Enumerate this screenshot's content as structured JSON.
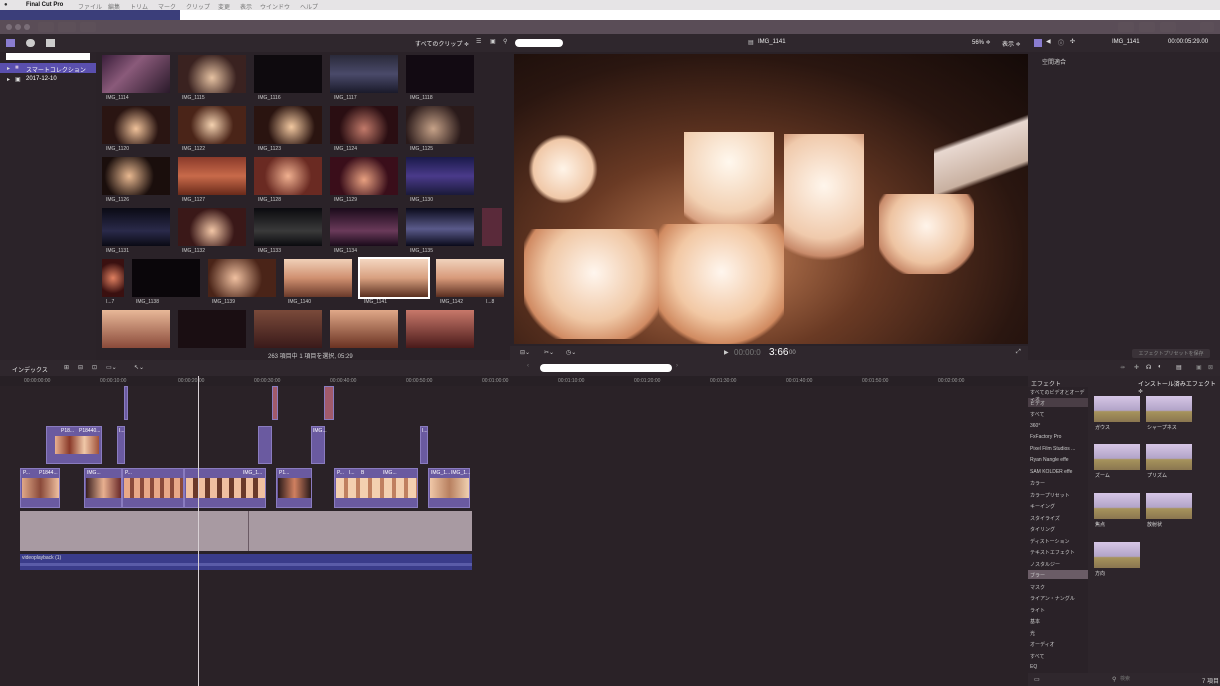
{
  "menubar": {
    "app": "Final Cut Pro",
    "items": [
      "ファイル",
      "編集",
      "トリム",
      "マーク",
      "クリップ",
      "変更",
      "表示",
      "ウインドウ",
      "ヘルプ"
    ]
  },
  "browser": {
    "filter": "すべてのクリップ ≑",
    "status": "263 項目中 1 項目を選択, 05:29",
    "clips": [
      "IMG_1114",
      "IMG_1115",
      "IMG_1116",
      "IMG_1117",
      "IMG_1118",
      "IMG_1120",
      "IMG_1122",
      "IMG_1123",
      "IMG_1124",
      "IMG_1125",
      "IMG_1126",
      "IMG_1127",
      "IMG_1128",
      "IMG_1129",
      "IMG_1130",
      "IMG_1131",
      "IMG_1132",
      "IMG_1133",
      "IMG_1134",
      "IMG_1135",
      "I...7",
      "IMG_1138",
      "IMG_1139",
      "IMG_1140",
      "IMG_1141",
      "IMG_1142",
      "I...8"
    ]
  },
  "library": {
    "items": [
      "スマートコレクション",
      "2017-12-10"
    ]
  },
  "viewer": {
    "clip_name": "IMG_1141",
    "zoom": "56% ≑",
    "view": "表示 ≑",
    "timecode": "00:00:03:66",
    "timecode_main": "3:66",
    "timecode_frames": "00"
  },
  "inspector": {
    "clip_name": "IMG_1141",
    "duration": "00:00:05:29.00",
    "label": "空間適合",
    "preset_button": "エフェクトプリセットを保存"
  },
  "timeline": {
    "index_label": "インデックス",
    "ruler": [
      "00:00:00:00",
      "00:00:10:00",
      "00:00:20:00",
      "00:00:30:00",
      "00:00:40:00",
      "00:00:50:00",
      "00:01:00:00",
      "00:01:10:00",
      "00:01:20:00",
      "00:01:30:00",
      "00:01:40:00",
      "00:01:50:00",
      "00:02:00:00"
    ],
    "audio_label": "videoplayback (1)",
    "connected_labels": [
      "P18...",
      "P18440...",
      "I...",
      "IMG...",
      "I..."
    ],
    "primary_labels": [
      "P...",
      "P1844...",
      "IMG...",
      "P...",
      "IMG_1...",
      "P1...",
      "P...",
      "I...",
      "B",
      "IMG...",
      "IMG_1...",
      "IMG_1..."
    ]
  },
  "effects": {
    "header": "エフェクト",
    "installed": "インストール済みエフェクト ≑",
    "categories": [
      "すべてのビデオとオーディオ",
      "ビデオ",
      "すべて",
      "360°",
      "FxFactory Pro",
      "Pixel Film Studios ...",
      "Ryan Nangle effe",
      "SAM KOLDER effe",
      "カラー",
      "カラープリセット",
      "キーイング",
      "スタイライズ",
      "タイリング",
      "ディストーション",
      "テキストエフェクト",
      "ノスタルジー",
      "ブラー",
      "マスク",
      "ライアン・ナングル",
      "ライト",
      "基本",
      "光",
      "オーディオ",
      "すべて",
      "EQ"
    ],
    "thumbs": [
      "ガウス",
      "シャープネス",
      "ズーム",
      "プリズム",
      "焦点",
      "放射状",
      "方向"
    ],
    "count": "7 項目",
    "search_placeholder": "検索"
  }
}
